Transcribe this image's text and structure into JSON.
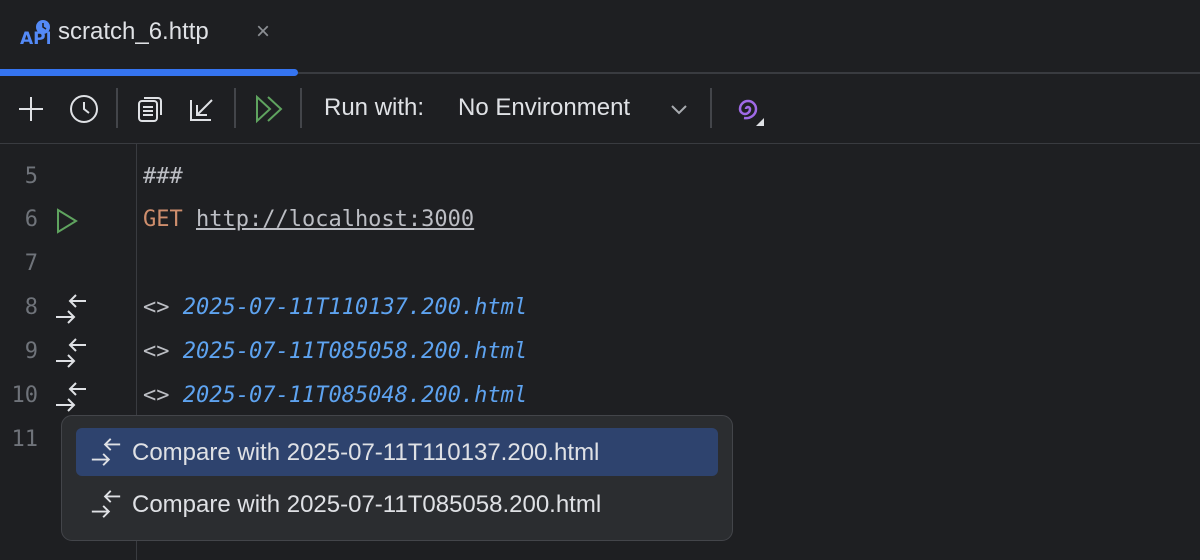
{
  "tab": {
    "title": "scratch_6.http",
    "icon": "api-file-icon",
    "close": "×"
  },
  "toolbar": {
    "run_with_label": "Run with:",
    "environment": "No Environment"
  },
  "editor": {
    "lines": [
      {
        "n": "5",
        "text": "###"
      },
      {
        "n": "6",
        "method": "GET",
        "url": "http://localhost:3000"
      },
      {
        "n": "7",
        "text": ""
      },
      {
        "n": "8",
        "prefix": "<>",
        "file": "2025-07-11T110137.200.html"
      },
      {
        "n": "9",
        "prefix": "<>",
        "file": "2025-07-11T085058.200.html"
      },
      {
        "n": "10",
        "prefix": "<>",
        "file": "2025-07-11T085048.200.html"
      },
      {
        "n": "11",
        "text": ""
      }
    ]
  },
  "popup": {
    "items": [
      {
        "label": "Compare with 2025-07-11T110137.200.html",
        "selected": true
      },
      {
        "label": "Compare with 2025-07-11T085058.200.html",
        "selected": false
      }
    ]
  },
  "colors": {
    "accent": "#3574f0",
    "file": "#5ea3f0",
    "keyword": "#cf8e6d",
    "run": "#5fa35f",
    "selection": "#2e436e"
  }
}
